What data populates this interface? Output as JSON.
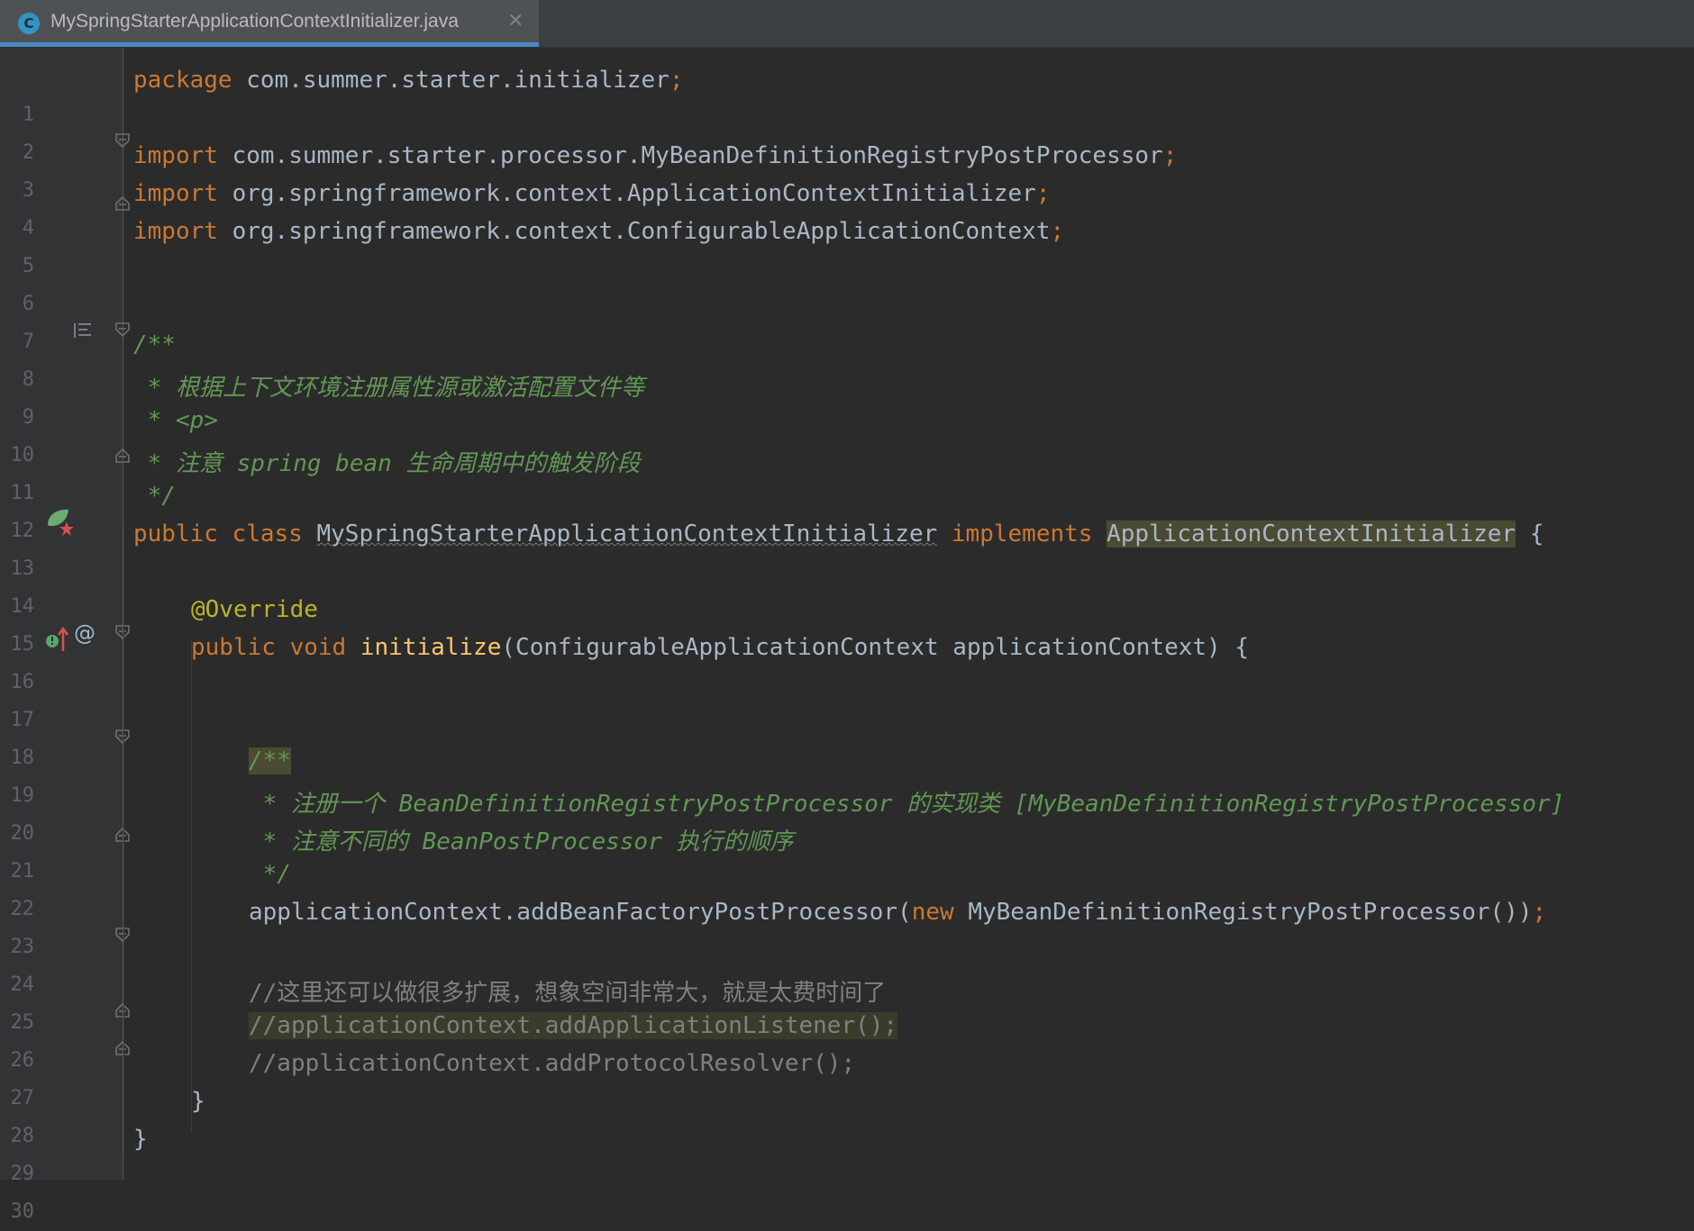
{
  "tab": {
    "title": "MySpringStarterApplicationContextInitializer.java",
    "icon": "class-c-icon",
    "icon_letter": "C"
  },
  "gutter": {
    "line_numbers": [
      "1",
      "2",
      "3",
      "4",
      "5",
      "6",
      "7",
      "8",
      "9",
      "10",
      "11",
      "12",
      "13",
      "14",
      "15",
      "16",
      "17",
      "18",
      "19",
      "20",
      "21",
      "22",
      "23",
      "24",
      "25",
      "26",
      "27",
      "28",
      "29",
      "30"
    ]
  },
  "code": {
    "l1": {
      "kw": "package",
      "rest": " com.summer.starter.initializer",
      "semi": ";"
    },
    "l3": {
      "kw": "import",
      "rest": " com.summer.starter.processor.MyBeanDefinitionRegistryPostProcessor",
      "semi": ";"
    },
    "l4": {
      "kw": "import",
      "rest": " org.springframework.context.ApplicationContextInitializer",
      "semi": ";"
    },
    "l5": {
      "kw": "import",
      "rest": " org.springframework.context.ConfigurableApplicationContext",
      "semi": ";"
    },
    "l8": "/**",
    "l9": " * 根据上下文环境注册属性源或激活配置文件等",
    "l10": " * <p>",
    "l11": " * 注意 spring bean 生命周期中的触发阶段",
    "l12": " */",
    "l13": {
      "kw1": "public class",
      "name": "MySpringStarterApplicationContextInitializer",
      "kw2": "implements",
      "iface": "ApplicationContextInitializer",
      "brace": " {"
    },
    "l15": "@Override",
    "l16": {
      "kw": "public void",
      "fn": "initialize",
      "rest": "(ConfigurableApplicationContext applicationContext) {"
    },
    "l19": "/**",
    "l20": " * 注册一个 BeanDefinitionRegistryPostProcessor 的实现类 [MyBeanDefinitionRegistryPostProcessor]",
    "l21": " * 注意不同的 BeanPostProcessor 执行的顺序",
    "l22": " */",
    "l23": {
      "a": "applicationContext.addBeanFactoryPostProcessor(",
      "kw": "new",
      "b": " MyBeanDefinitionRegistryPostProcessor())",
      "semi": ";"
    },
    "l25": "//这里还可以做很多扩展，想象空间非常大，就是太费时间了",
    "l26": "//applicationContext.addApplicationListener();",
    "l27": "//applicationContext.addProtocolResolver();",
    "l28": "}",
    "l29": "}"
  },
  "gutter_icons": [
    "structure-icon",
    "spring-bean-icon",
    "implementing-method-icon",
    "at-sign-icon"
  ],
  "colors": {
    "background": "#2b2b2b",
    "keyword": "#cc7832",
    "comment": "#629755",
    "annotation": "#bbb529",
    "method": "#ffc66d",
    "text": "#a9b7c6",
    "accent": "#4a88c7"
  }
}
